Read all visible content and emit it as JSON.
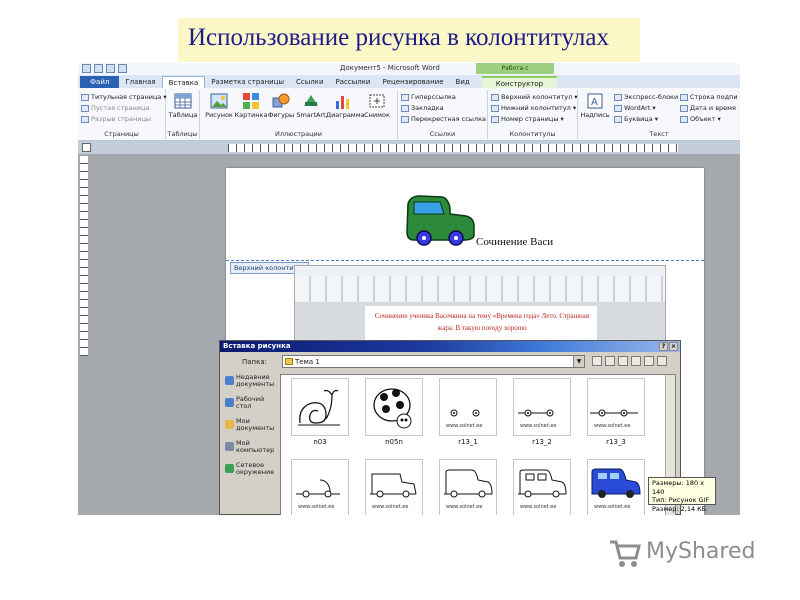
{
  "slide": {
    "title": "Использование рисунка в колонтитулах"
  },
  "window": {
    "title": "Документ5 - Microsoft Word",
    "context_group": "Работа с колонтитулами"
  },
  "tabs": [
    "Файл",
    "Главная",
    "Вставка",
    "Разметка страницы",
    "Ссылки",
    "Рассылки",
    "Рецензирование",
    "Вид",
    "Конструктор"
  ],
  "ribbon": {
    "pages": {
      "caption": "Страницы",
      "items": [
        "Титульная страница",
        "Пустая страница",
        "Разрыв страницы"
      ]
    },
    "tables": {
      "caption": "Таблицы",
      "button": "Таблица"
    },
    "illustrations": {
      "caption": "Иллюстрации",
      "buttons": [
        "Рисунок",
        "Картинка",
        "Фигуры",
        "SmartArt",
        "Диаграмма",
        "Снимок"
      ]
    },
    "links": {
      "caption": "Ссылки",
      "items": [
        "Гиперссылка",
        "Закладка",
        "Перекрестная ссылка"
      ]
    },
    "header_footer": {
      "caption": "Колонтитулы",
      "items": [
        "Верхний колонтитул",
        "Нижний колонтитул",
        "Номер страницы"
      ]
    },
    "text": {
      "caption": "Текст",
      "button": "Надпись",
      "items": [
        "Экспресс-блоки",
        "WordArt",
        "Буквица"
      ],
      "items2": [
        "Строка подпи",
        "Дата и время",
        "Объект"
      ]
    }
  },
  "document": {
    "caption": "Сочинение Васи",
    "header_label": "Верхний колонтитул",
    "inner_text": "Сочинение ученика Васечкина на тему «Времена года» Лето. Страшная жара. В такую погоду хорошо"
  },
  "dialog": {
    "title": "Вставка рисунка",
    "look_in_label": "Папка:",
    "folder": "Тема 1",
    "places": [
      "Недавние документы",
      "Рабочий стол",
      "Мои документы",
      "Мой компьютер",
      "Сетевое окружение"
    ],
    "files": [
      "n03",
      "n05n",
      "r13_1",
      "r13_2",
      "r13_3"
    ],
    "site_label": "www.solnet.ee",
    "tooltip": {
      "size": "Размеры: 180 x 140",
      "type": "Тип: Рисунок GIF",
      "weight": "Размер: 2,14 КБ"
    }
  },
  "logo": {
    "text": "MyShared"
  }
}
